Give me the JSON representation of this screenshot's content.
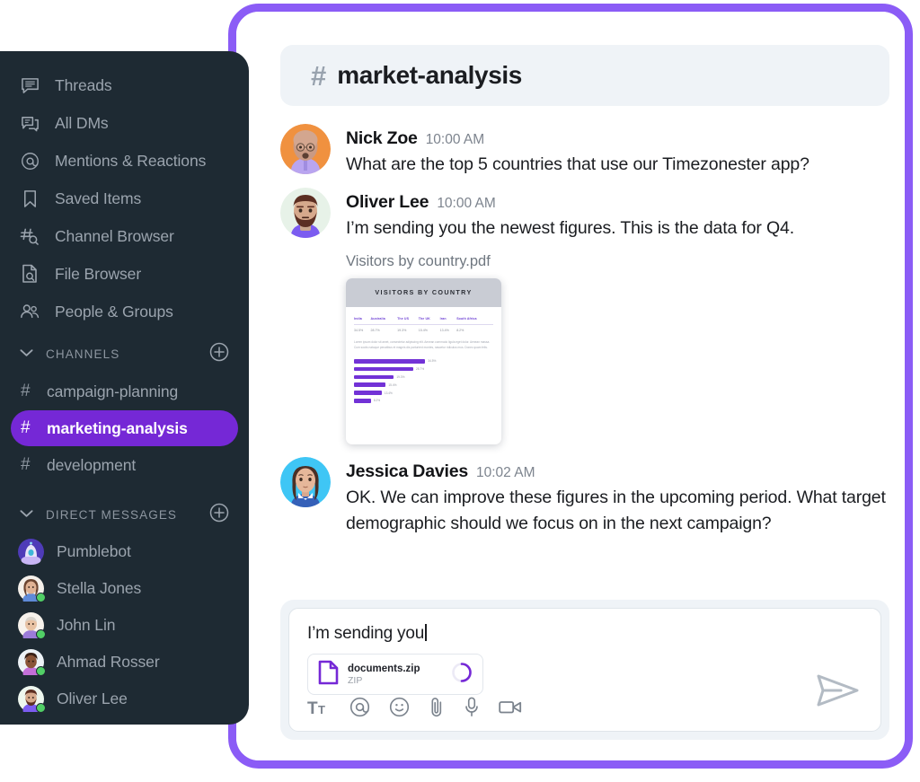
{
  "theme": {
    "accent_purple": "#7528d6",
    "frame_purple": "#8b5cf6",
    "sidebar_bg": "#1e2a33",
    "header_bg": "#eff3f7",
    "muted_text": "#9ba4ae",
    "online_green": "#51cf66"
  },
  "sidebar": {
    "nav_items": [
      {
        "label": "Threads",
        "icon": "threads-icon"
      },
      {
        "label": "All DMs",
        "icon": "all-dms-icon"
      },
      {
        "label": "Mentions & Reactions",
        "icon": "at-mention-icon"
      },
      {
        "label": "Saved Items",
        "icon": "bookmark-icon"
      },
      {
        "label": "Channel Browser",
        "icon": "channel-search-icon"
      },
      {
        "label": "File Browser",
        "icon": "file-search-icon"
      },
      {
        "label": "People & Groups",
        "icon": "people-icon"
      }
    ],
    "channels_section": {
      "title": "CHANNELS",
      "collapse_icon": "chevron-down-icon",
      "add_icon": "plus-circle-icon",
      "items": [
        {
          "hash": "#",
          "label": "campaign-planning",
          "active": false
        },
        {
          "hash": "#",
          "label": "marketing-analysis",
          "active": true
        },
        {
          "hash": "#",
          "label": "development",
          "active": false
        }
      ]
    },
    "dm_section": {
      "title": "DIRECT MESSAGES",
      "collapse_icon": "chevron-down-icon",
      "add_icon": "plus-circle-icon",
      "items": [
        {
          "label": "Pumblebot",
          "online": false,
          "avatar": "bot"
        },
        {
          "label": "Stella Jones",
          "online": true,
          "avatar": "stella"
        },
        {
          "label": "John Lin",
          "online": true,
          "avatar": "john"
        },
        {
          "label": "Ahmad Rosser",
          "online": true,
          "avatar": "ahmad"
        },
        {
          "label": "Oliver Lee",
          "online": true,
          "avatar": "oliver"
        }
      ]
    }
  },
  "channel_header": {
    "hash": "#",
    "title": "market-analysis"
  },
  "messages": [
    {
      "author": "Nick Zoe",
      "time": "10:00 AM",
      "text": "What are the top 5 countries that use our Timezonester app?",
      "avatar": "nick"
    },
    {
      "author": "Oliver Lee",
      "time": "10:00 AM",
      "text": " I’m sending you the newest figures. This is the data for Q4.",
      "avatar": "oliver"
    },
    {
      "author": "Jessica Davies",
      "time": "10:02 AM",
      "text": "OK. We can improve these figures in the upcoming period. What target demographic should we focus on in the next campaign?",
      "avatar": "jessica"
    }
  ],
  "attachment": {
    "file_name": "Visitors by country.pdf",
    "preview": {
      "banner_title": "VISITORS BY COUNTRY",
      "columns": [
        "India",
        "Australia",
        "The US",
        "The UK",
        "Iran",
        "South Africa"
      ],
      "values": [
        "34.5%",
        "28.7%",
        "19.3%",
        "15.4%",
        "13.4%",
        "8.2%"
      ],
      "lorem": "Lorem ipsum dolor sit amet, consectetur adipiscing elit. Aenean commodo ligula eget dolor. Aenean massa. Cum sociis natoque penatibus et magnis dis parturient montes, nascetur ridiculus mus. Donec quam felis."
    }
  },
  "chart_data": {
    "type": "bar",
    "title": "VISITORS BY COUNTRY",
    "orientation": "horizontal",
    "categories": [
      "India",
      "Australia",
      "The US",
      "The UK",
      "Iran",
      "South Africa"
    ],
    "values": [
      34.5,
      28.7,
      19.3,
      15.4,
      13.4,
      8.2
    ],
    "value_labels": [
      "34.5%",
      "28.7%",
      "19.3%",
      "15.4%",
      "13.4%",
      "8.2%"
    ],
    "xlabel": "",
    "ylabel": "",
    "xlim": [
      0,
      40
    ],
    "grid": false,
    "legend": false,
    "bar_color": "#7232d6"
  },
  "composer": {
    "draft_text": "I’m sending you",
    "file_chip": {
      "name": "documents.zip",
      "type": "ZIP",
      "upload_progress": 75,
      "spinner_icon": "upload-progress-spinner"
    },
    "tools": [
      {
        "name": "text-format-icon",
        "label": "Tt"
      },
      {
        "name": "mention-icon",
        "label": "@"
      },
      {
        "name": "emoji-icon",
        "label": "☺"
      },
      {
        "name": "attachment-icon",
        "label": "paperclip"
      },
      {
        "name": "microphone-icon",
        "label": "mic"
      },
      {
        "name": "video-icon",
        "label": "video"
      }
    ],
    "send_icon": "send-icon"
  }
}
